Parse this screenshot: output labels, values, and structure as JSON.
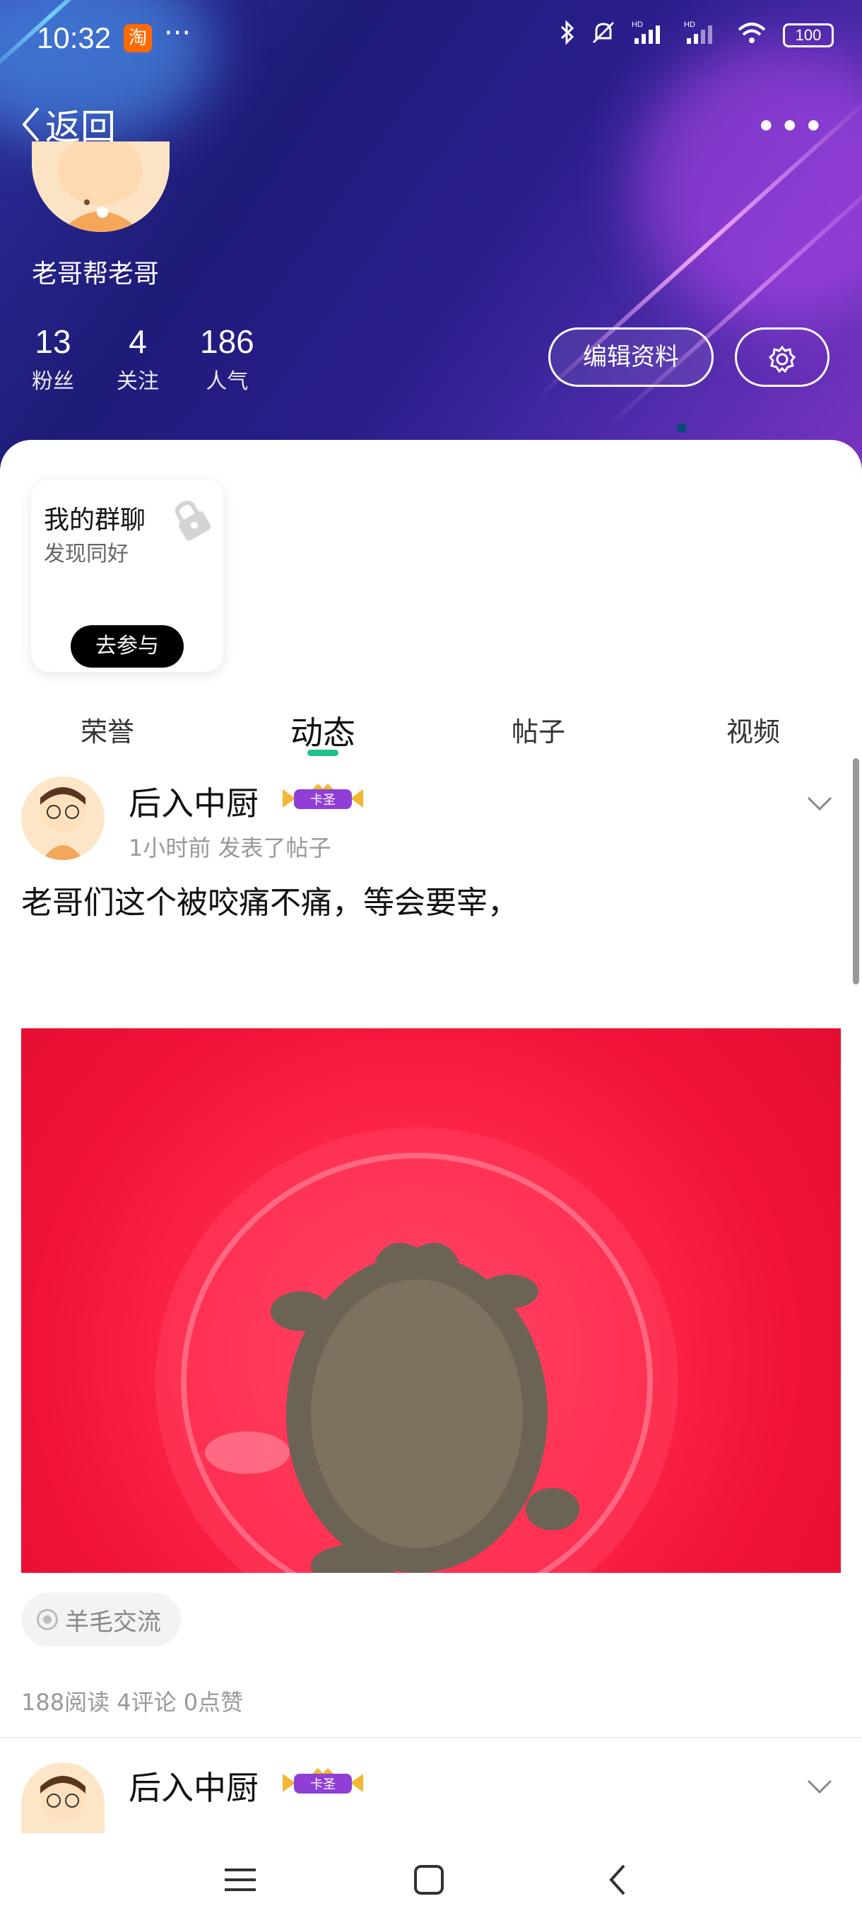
{
  "status_bar": {
    "time": "10:32",
    "app_icon": "taobao-icon",
    "dots": "···",
    "battery": "100",
    "icons": [
      "bluetooth-icon",
      "mute-icon",
      "signal-hd-icon",
      "signal-hd-icon",
      "wifi-icon",
      "battery-icon"
    ]
  },
  "header": {
    "back_label": "返回",
    "more_icon": "more-icon",
    "username": "老哥帮老哥",
    "stats": [
      {
        "value": "13",
        "label": "粉丝"
      },
      {
        "value": "4",
        "label": "关注"
      },
      {
        "value": "186",
        "label": "人气"
      }
    ],
    "edit_button": "编辑资料",
    "settings_icon": "gear-icon"
  },
  "group_card": {
    "title": "我的群聊",
    "subtitle": "发现同好",
    "button": "去参与",
    "lock_icon": "lock-icon"
  },
  "tabs": [
    {
      "label": "荣誉",
      "active": false
    },
    {
      "label": "动态",
      "active": true
    },
    {
      "label": "帖子",
      "active": false
    },
    {
      "label": "视频",
      "active": false
    }
  ],
  "posts": [
    {
      "author": "后入中厨",
      "badge": "卡圣",
      "meta": "1小时前 发表了帖子",
      "text": "老哥们这个被咬痛不痛，等会要宰，",
      "tag": "羊毛交流",
      "stats": "188阅读 4评论 0点赞"
    },
    {
      "author": "后入中厨",
      "badge": "卡圣"
    }
  ],
  "nav": {
    "menu_icon": "menu-icon",
    "home_icon": "home-icon",
    "back_icon": "back-icon"
  },
  "colors": {
    "accent": "#1ec08c",
    "header_bg": "#2a1e8c",
    "image_bg": "#f01238"
  }
}
